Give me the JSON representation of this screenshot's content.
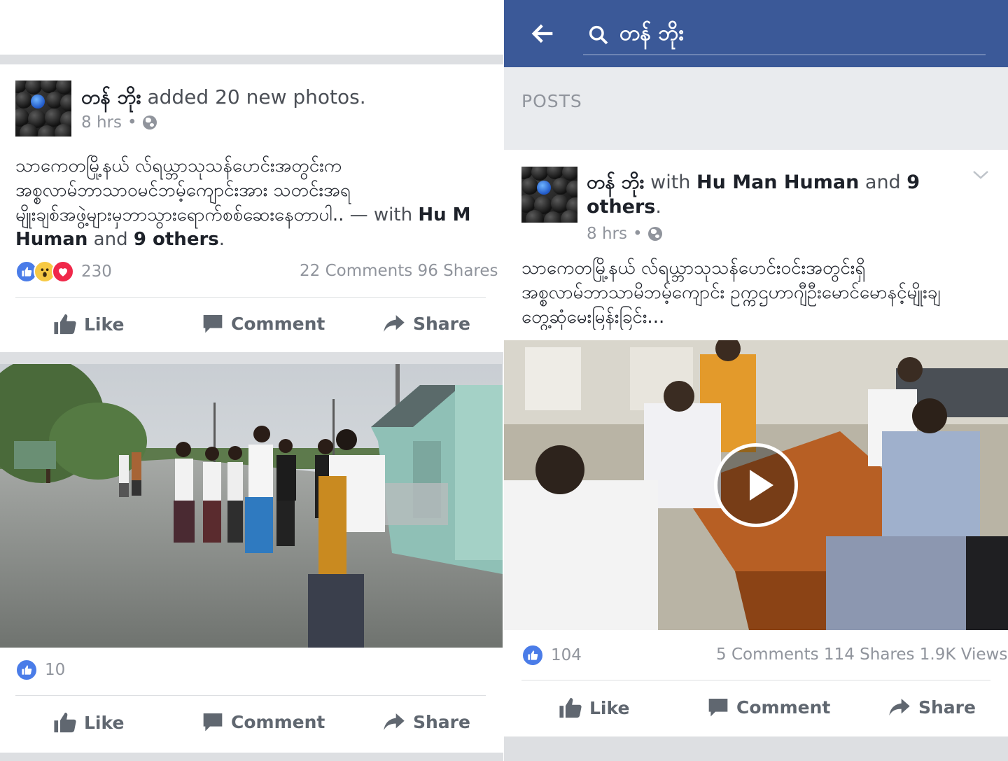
{
  "colors": {
    "facebook_blue": "#3b5998",
    "like_blue": "#4a7ce8",
    "love_red": "#f0284a",
    "wow_yellow": "#f7c944",
    "meta_gray": "#90949c",
    "band_gray": "#dddfe2"
  },
  "left_feed": {
    "photo_post": {
      "author": "တန် ဘိုး",
      "headline_rest": " added 20 new photos.",
      "time": "8 hrs",
      "dot": "•",
      "privacy_icon": "globe-icon",
      "text_lines": [
        "သာကေတမြို့နယ် လ်ရယ္ဘာသုသန်ပောင်းအတွင်းက",
        "အစ္စလာမ်ဘာသာဝမင်ဘမ့်ကျောင်းအား သတင်းအရ",
        "မျိုးချစ်အဖွဲ့များမှဘာသွားရောက်စစ်ဆေးနေတာပါ.."
      ],
      "with_dash": " — with ",
      "with_name_start": "Hu M",
      "with_name_end": "Human",
      "and_word": " and ",
      "others": "9 others",
      "period": ".",
      "reactions": [
        "like-icon",
        "wow-icon",
        "love-icon"
      ],
      "reaction_count": "230",
      "stats": "22 Comments 96 Shares",
      "actions": {
        "like": "Like",
        "comment": "Comment",
        "share": "Share"
      }
    },
    "second_post": {
      "reaction_count": "10",
      "actions": {
        "like": "Like",
        "comment": "Comment",
        "share": "Share"
      }
    }
  },
  "right_feed": {
    "header": {
      "back_icon": "back-arrow-icon",
      "search_icon": "search-icon",
      "search_query": "တန် ဘိုး"
    },
    "section_label": "POSTS",
    "video_post": {
      "author": "တန် ဘိုး",
      "with_word": " with ",
      "tag_name": "Hu Man Human",
      "and_word": " and ",
      "count": "9",
      "others": "others",
      "period": ".",
      "time": "8 hrs",
      "dot": "•",
      "privacy_icon": "globe-icon",
      "menu_icon": "chevron-down-icon",
      "text_lines": [
        "သာကေတမြို့နယ် လ်ရယ္ဘာသုသန်ပောင်းဝင်းအတွင်းရှိ",
        "အစ္စလာမ်ဘာသာမိဘမ့်ကျောင်း ဥက္ကဌဟာဂျီဦးမောင်မောနင့်မျိုးချ",
        "တွေ့ဆုံမေးမြန်းခြင်း..."
      ],
      "play_icon": "play-icon",
      "like_count": "104",
      "stats": "5 Comments 114 Shares 1.9K Views",
      "actions": {
        "like": "Like",
        "comment": "Comment",
        "share": "Share"
      }
    }
  }
}
